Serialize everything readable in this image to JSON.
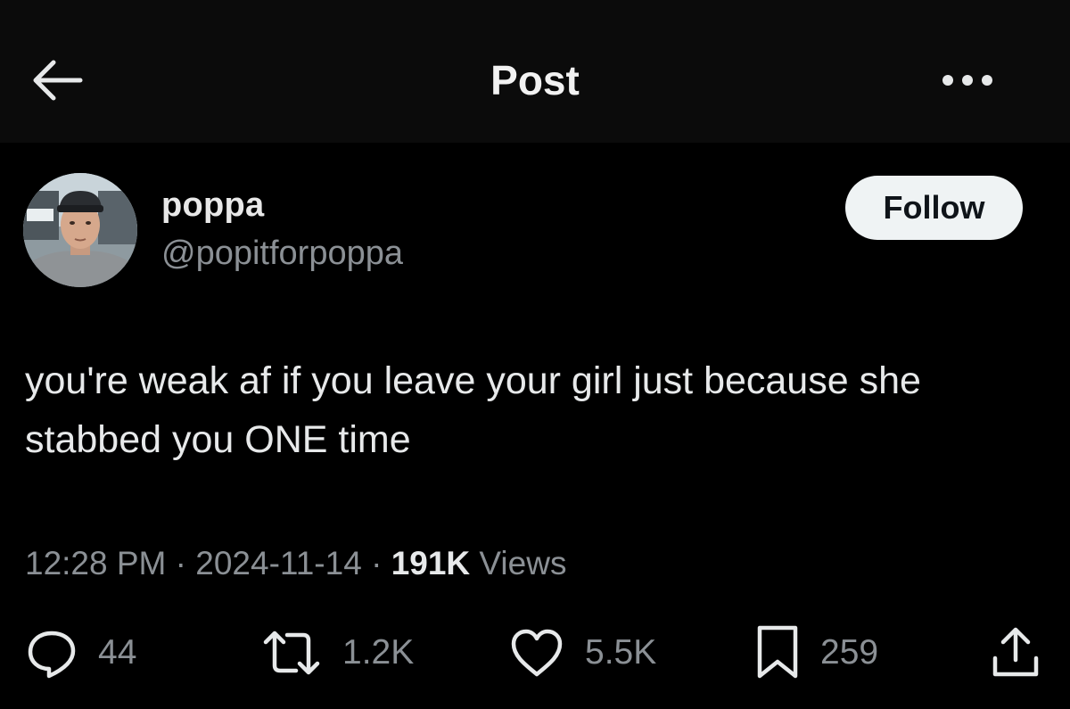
{
  "header": {
    "title": "Post",
    "back_icon": "arrow-left-icon",
    "more_icon": "more-horizontal-icon"
  },
  "author": {
    "name": "poppa",
    "handle": "@popitforpoppa",
    "follow_label": "Follow"
  },
  "post": {
    "text": "you're weak af if you leave your girl just because she stabbed you ONE time",
    "time": "12:28 PM",
    "date": "2024-11-14",
    "separator": " · ",
    "views_count": "191K",
    "views_label": " Views"
  },
  "actions": {
    "replies": "44",
    "reposts": "1.2K",
    "likes": "5.5K",
    "bookmarks": "259"
  },
  "colors": {
    "background": "#000000",
    "text": "#e7e9ea",
    "secondary_text": "#8b9095",
    "follow_bg": "#eff3f4"
  }
}
